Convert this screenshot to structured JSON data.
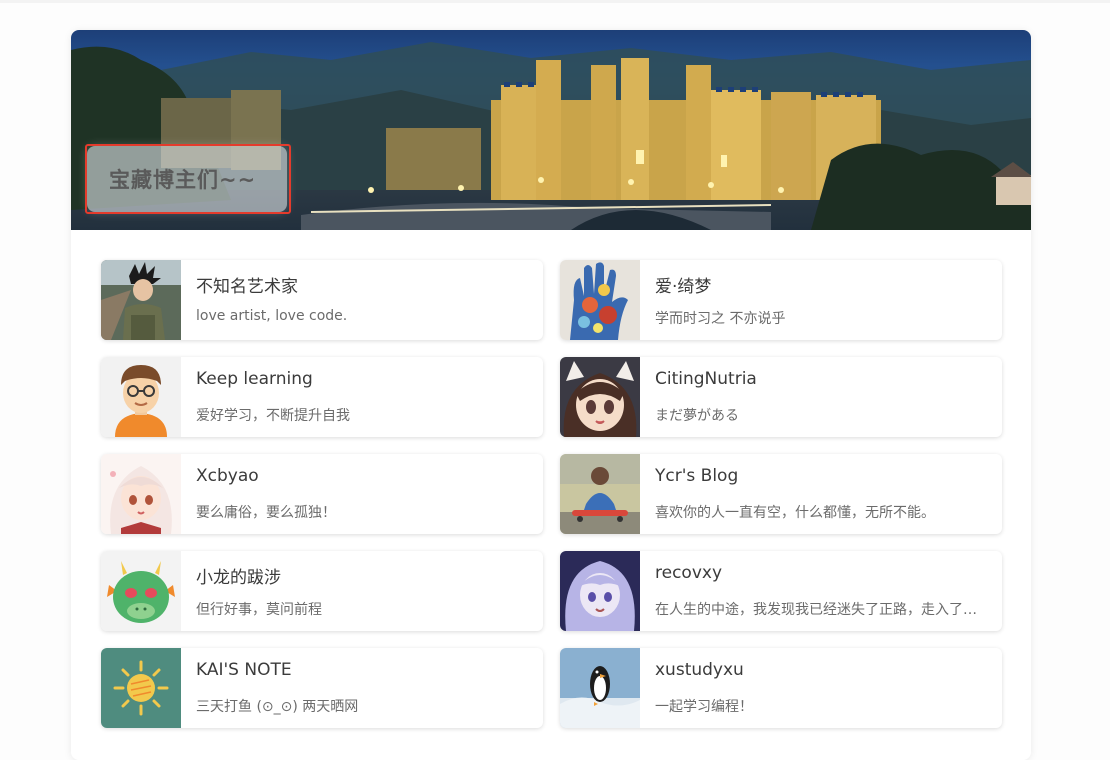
{
  "banner": {
    "title": "宝藏博主们~~",
    "image": "castle-at-night-landscape"
  },
  "friends": [
    {
      "name": "不知名艺术家",
      "desc": "love artist, love code.",
      "avatar": "boy-with-spiky-hair-photo"
    },
    {
      "name": "爱·绮梦",
      "desc": "学而时习之 不亦说乎",
      "avatar": "painted-hand-photo"
    },
    {
      "name": "Keep learning",
      "desc": "爱好学习，不断提升自我",
      "avatar": "cartoon-boy-with-glasses"
    },
    {
      "name": "CitingNutria",
      "desc": "まだ夢がある",
      "avatar": "anime-girl-cat-ears"
    },
    {
      "name": "Xcbyao",
      "desc": "要么庸俗，要么孤独！",
      "avatar": "anime-girl-white-hair"
    },
    {
      "name": "Ycr's Blog",
      "desc": "喜欢你的人一直有空，什么都懂，无所不能。",
      "avatar": "child-on-skateboard-photo"
    },
    {
      "name": "小龙的跋涉",
      "desc": "但行好事，莫问前程",
      "avatar": "green-dragon-emoji"
    },
    {
      "name": "recovxy",
      "desc": "在人生的中途，我发现我已经迷失了正路，走入了一座幽暗的森林",
      "avatar": "anime-girl-purple-hair"
    },
    {
      "name": "KAI'S NOTE",
      "desc": "三天打鱼 (⊙_⊙) 两天晒网",
      "avatar": "sun-icon"
    },
    {
      "name": "xustudyxu",
      "desc": "一起学习编程！",
      "avatar": "penguin-photo"
    }
  ]
}
